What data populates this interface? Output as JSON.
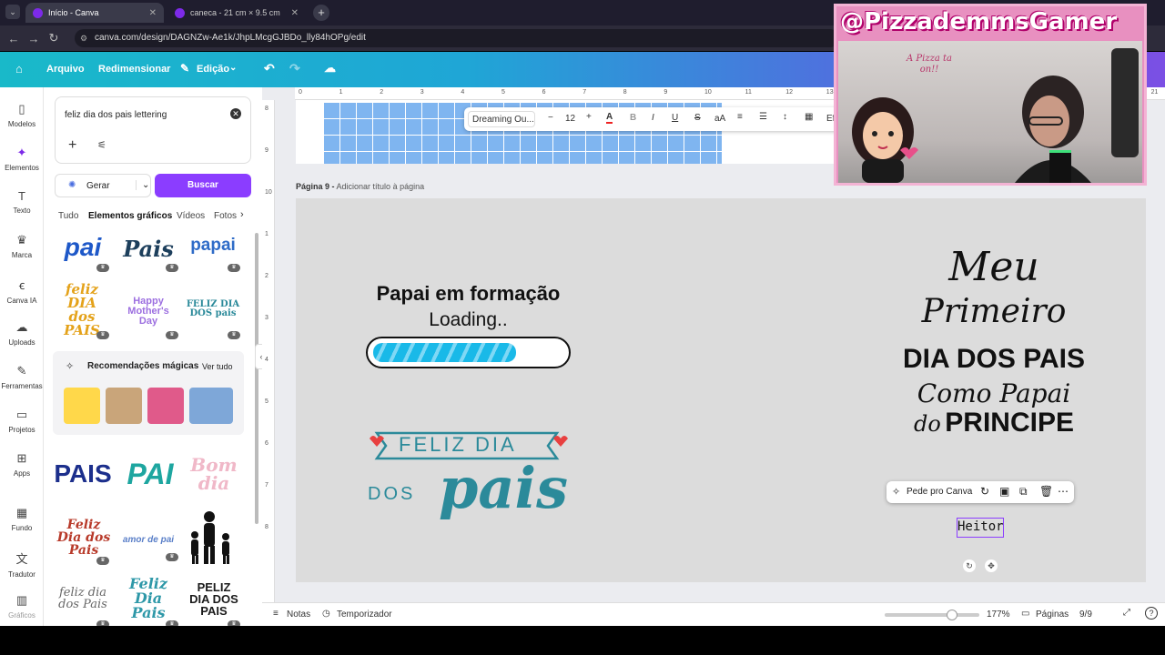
{
  "browser": {
    "tabs": [
      {
        "label": "Início - Canva",
        "active": true
      },
      {
        "label": "caneca - 21 cm × 9.5 cm",
        "active": false
      }
    ],
    "url": "canva.com/design/DAGNZw-Ae1k/JhpLMcgGJBDo_lly84hOPg/edit"
  },
  "canva_top": {
    "arquivo": "Arquivo",
    "redimensionar": "Redimensionar",
    "edicao": "Edição"
  },
  "rail": [
    {
      "label": "Modelos",
      "icon": "layout-icon"
    },
    {
      "label": "Elementos",
      "icon": "shapes-icon",
      "active": true
    },
    {
      "label": "Texto",
      "icon": "text-icon"
    },
    {
      "label": "Marca",
      "icon": "brand-icon"
    },
    {
      "label": "Canva IA",
      "icon": "magic-icon"
    },
    {
      "label": "Uploads",
      "icon": "upload-icon"
    },
    {
      "label": "Ferramentas",
      "icon": "pen-icon"
    },
    {
      "label": "Projetos",
      "icon": "folder-icon"
    },
    {
      "label": "Apps",
      "icon": "apps-icon"
    },
    {
      "label": "Fundo",
      "icon": "pattern-icon"
    },
    {
      "label": "Tradutor",
      "icon": "translate-icon"
    },
    {
      "label": "Gráficos",
      "icon": "chart-icon"
    }
  ],
  "panel": {
    "search_query": "feliz dia dos pais lettering",
    "gerar": "Gerar",
    "buscar": "Buscar",
    "tabs": [
      "Tudo",
      "Elementos gráficos",
      "Vídeos",
      "Fotos"
    ],
    "selected_tab": "Elementos gráficos",
    "magic_title": "Recomendações mágicas",
    "ver_tudo": "Ver tudo",
    "thumbs": {
      "t1": "pai",
      "t2": "Pais",
      "t3": "papai",
      "t4": "feliz DIA dos PAIS",
      "t5": "Happy Mother's Day",
      "t6": "FELIZ DIA DOS pais",
      "t7": "PAIS",
      "t8": "PAI",
      "t9": "Bom dia",
      "t10": "Feliz Dia dos Pais",
      "t11": "amor de pai",
      "t12": "Feliz Dia dos Pais",
      "t13": "feliz dia dos Pais",
      "t14": "Feliz Dia Pais",
      "t15": "PELIZ DIA DOS PAIS"
    }
  },
  "ruler": [
    "0",
    "1",
    "2",
    "3",
    "4",
    "5",
    "6",
    "7",
    "8",
    "9",
    "10",
    "11",
    "12",
    "13",
    "14",
    "15",
    "16",
    "17",
    "18",
    "19",
    "20",
    "21"
  ],
  "vruler": [
    "8",
    "9",
    "10",
    "1",
    "2",
    "3",
    "4",
    "5",
    "6",
    "7",
    "8"
  ],
  "text_toolbar": {
    "font": "Dreaming Ou...",
    "size": "12"
  },
  "page": {
    "label_prefix": "Página 9 -",
    "label_suffix": "Adicionar título à página",
    "title": "Papai em formação",
    "loading": "Loading..",
    "progress": 0.75,
    "feliz_dia": "FELIZ DIA",
    "dos": "DOS",
    "pais": "pais",
    "meu": "Meu",
    "primeiro": "Primeiro",
    "dia_dos_pais": "DIA DOS PAIS",
    "como_papai": "Como Papai",
    "do": "do",
    "principe": "PRINCIPE",
    "name": "Heitor"
  },
  "element_toolbar": {
    "pede": "Pede pro Canva"
  },
  "bottom": {
    "notas": "Notas",
    "temporizador": "Temporizador",
    "zoom": "177%",
    "paginas": "Páginas",
    "page_count": "9/9"
  },
  "overlay": {
    "handle": "@PizzademmsGamer",
    "sign": "A Pizza ta on!!"
  },
  "colors": {
    "accent": "#8b3dff",
    "teal": "#2b8a9a",
    "progress": "#19b9e8"
  }
}
